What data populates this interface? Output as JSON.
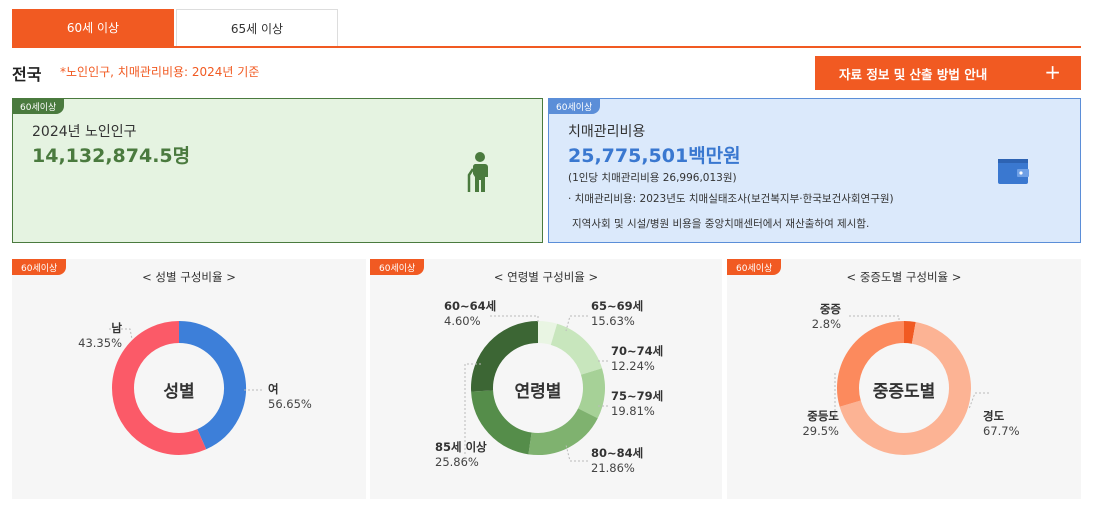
{
  "tabs": [
    {
      "label": "60세 이상",
      "active": true
    },
    {
      "label": "65세 이상",
      "active": false
    }
  ],
  "header": {
    "region": "전국",
    "basis": "*노인인구, 치매관리비용: 2024년 기준",
    "guide_button": "자료 정보 및 산출 방법 안내",
    "guide_icon": "plus-icon"
  },
  "cards": {
    "population": {
      "badge": "60세이상",
      "label": "2024년 노인인구",
      "value": "14,132,874.5명",
      "icon": "elderly-person-icon",
      "color": "#4a7a3e"
    },
    "cost": {
      "badge": "60세이상",
      "label": "치매관리비용",
      "value": "25,775,501백만원",
      "per_person": "(1인당 치매관리비용 26,996,013원)",
      "note1": "· 치매관리비용: 2023년도 치매실태조사(보건복지부·한국보건사회연구원)",
      "note2": "지역사회 및 시설/병원 비용을 중앙치매센터에서 재산출하여 제시함.",
      "icon": "wallet-icon",
      "color": "#3a78d0"
    }
  },
  "chart_data": [
    {
      "type": "pie",
      "badge": "60세이상",
      "title": "< 성별 구성비율 >",
      "center_label": "성별",
      "categories": [
        "남",
        "여"
      ],
      "values": [
        43.35,
        56.65
      ],
      "value_labels": [
        "43.35%",
        "56.65%"
      ],
      "colors": [
        "#3d7fd9",
        "#fb5a68"
      ]
    },
    {
      "type": "pie",
      "badge": "60세이상",
      "title": "< 연령별 구성비율 >",
      "center_label": "연령별",
      "categories": [
        "60~64세",
        "65~69세",
        "70~74세",
        "75~79세",
        "80~84세",
        "85세 이상"
      ],
      "values": [
        4.6,
        15.63,
        12.24,
        19.81,
        21.86,
        25.86
      ],
      "value_labels": [
        "4.60%",
        "15.63%",
        "12.24%",
        "19.81%",
        "21.86%",
        "25.86%"
      ],
      "colors": [
        "#e9f5e3",
        "#c8e6bd",
        "#a6d197",
        "#7fb26f",
        "#558d4a",
        "#3c6634"
      ]
    },
    {
      "type": "pie",
      "badge": "60세이상",
      "title": "< 중증도별 구성비율 >",
      "center_label": "중증도별",
      "categories": [
        "중증",
        "경도",
        "중등도"
      ],
      "values": [
        2.8,
        67.7,
        29.5
      ],
      "value_labels": [
        "2.8%",
        "67.7%",
        "29.5%"
      ],
      "colors": [
        "#f15a22",
        "#fcb394",
        "#fc8a5d"
      ]
    }
  ]
}
